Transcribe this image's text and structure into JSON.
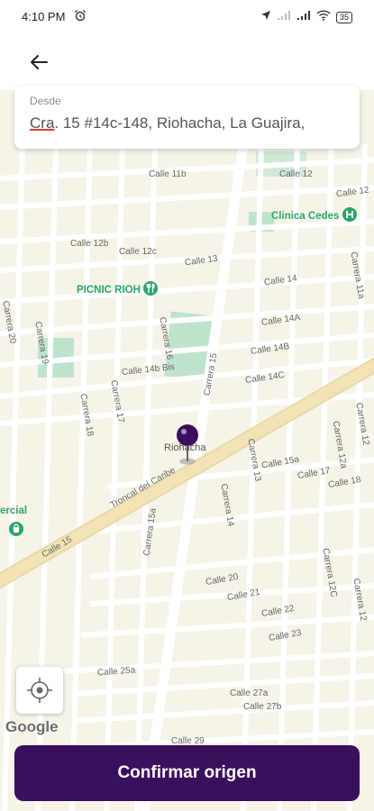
{
  "status_bar": {
    "time": "4:10 PM",
    "battery": "35"
  },
  "search": {
    "label": "Desde",
    "value_first": "Cra",
    "value_rest": ". 15 #14c-148, Riohacha, La Guajira,"
  },
  "map": {
    "streets": {
      "calle_11b": "Calle 11b",
      "calle_12": "Calle 12",
      "calle_12_right": "Calle 12",
      "calle_12b": "Calle 12b",
      "calle_12c": "Calle 12c",
      "calle_13": "Calle 13",
      "calle_14": "Calle 14",
      "calle_14a": "Calle 14A",
      "calle_14b": "Calle 14B",
      "calle_14c": "Calle 14C",
      "calle_14b_bis": "Calle 14b Bis",
      "calle_15": "Calle 15",
      "calle_15a": "Calle 15a",
      "calle_17": "Calle 17",
      "calle_18": "Calle 18",
      "calle_20": "Calle 20",
      "calle_21": "Calle 21",
      "calle_22": "Calle 22",
      "calle_23": "Calle 23",
      "calle_25a": "Calle 25a",
      "calle_27a": "Calle 27a",
      "calle_27b": "Calle 27b",
      "calle_29": "Calle 29",
      "carrera_20": "Carrera 20",
      "carrera_19": "Carrera 19",
      "carrera_18": "Carrera 18",
      "carrera_17": "Carrera 17",
      "carrera_16": "Carrera 16",
      "carrera_15": "Carrera 15",
      "carrera_15a": "Carrera 15a",
      "carrera_14": "Carrera 14",
      "carrera_13": "Carrera 13",
      "carrera_12": "Carrera 12",
      "carrera_12a": "Carrera 12a",
      "carrera_12c": "Carrera 12C",
      "carrera_12_low": "Carrera 12",
      "carrera_11a": "Carrera 11a",
      "troncal": "Troncal del Caribe"
    },
    "pois": {
      "clinica": "Clinica Cedes",
      "picnic": "PICNIC RIOH",
      "comercial": "ercial"
    },
    "pin_label": "Riohacha",
    "attribution": "Google",
    "colors": {
      "background": "#f6f3e9",
      "park": "#bfe3cf",
      "poi": "#2aa56b",
      "pin": "#3a0f5c",
      "highway": "#f1e3b6"
    }
  },
  "confirm_button": {
    "label": "Confirmar origen"
  }
}
